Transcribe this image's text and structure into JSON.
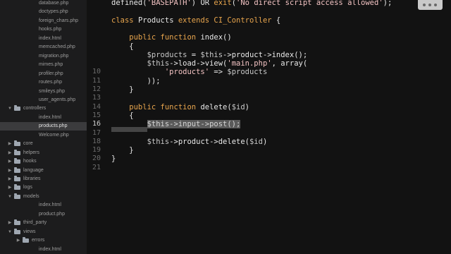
{
  "sidebar": {
    "items": [
      {
        "label": "database.php",
        "kind": "file",
        "depth": 3
      },
      {
        "label": "doctypes.php",
        "kind": "file",
        "depth": 3
      },
      {
        "label": "foreign_chars.php",
        "kind": "file",
        "depth": 3
      },
      {
        "label": "hooks.php",
        "kind": "file",
        "depth": 3
      },
      {
        "label": "index.html",
        "kind": "file",
        "depth": 3
      },
      {
        "label": "memcached.php",
        "kind": "file",
        "depth": 3
      },
      {
        "label": "migration.php",
        "kind": "file",
        "depth": 3
      },
      {
        "label": "mimes.php",
        "kind": "file",
        "depth": 3
      },
      {
        "label": "profiler.php",
        "kind": "file",
        "depth": 3
      },
      {
        "label": "routes.php",
        "kind": "file",
        "depth": 3
      },
      {
        "label": "smileys.php",
        "kind": "file",
        "depth": 3
      },
      {
        "label": "user_agents.php",
        "kind": "file",
        "depth": 3
      },
      {
        "label": "controllers",
        "kind": "folder-open",
        "depth": 2
      },
      {
        "label": "index.html",
        "kind": "file",
        "depth": 3
      },
      {
        "label": "products.php",
        "kind": "file",
        "depth": 3,
        "selected": true
      },
      {
        "label": "Welcome.php",
        "kind": "file",
        "depth": 3
      },
      {
        "label": "core",
        "kind": "folder",
        "depth": 2
      },
      {
        "label": "helpers",
        "kind": "folder",
        "depth": 2
      },
      {
        "label": "hooks",
        "kind": "folder",
        "depth": 2
      },
      {
        "label": "language",
        "kind": "folder",
        "depth": 2
      },
      {
        "label": "libraries",
        "kind": "folder",
        "depth": 2
      },
      {
        "label": "logs",
        "kind": "folder",
        "depth": 2
      },
      {
        "label": "models",
        "kind": "folder-open",
        "depth": 2
      },
      {
        "label": "index.html",
        "kind": "file",
        "depth": 3
      },
      {
        "label": "product.php",
        "kind": "file",
        "depth": 3
      },
      {
        "label": "third_party",
        "kind": "folder",
        "depth": 2
      },
      {
        "label": "views",
        "kind": "folder-open",
        "depth": 2
      },
      {
        "label": "errors",
        "kind": "folder",
        "depth": 3
      },
      {
        "label": "index.html",
        "kind": "file",
        "depth": 3
      }
    ]
  },
  "editor": {
    "active_line": "16",
    "lines": [
      {
        "num": "",
        "tokens": [
          {
            "t": "defined(",
            "c": "fn"
          },
          {
            "t": "'BASEPATH'",
            "c": "str"
          },
          {
            "t": ") OR ",
            "c": "fn"
          },
          {
            "t": "exit",
            "c": "kw"
          },
          {
            "t": "(",
            "c": "fn"
          },
          {
            "t": "'No direct script access allowed'",
            "c": "str"
          },
          {
            "t": ");",
            "c": "fn"
          }
        ]
      },
      {
        "num": "",
        "tokens": []
      },
      {
        "num": "",
        "tokens": [
          {
            "t": "class ",
            "c": "kw"
          },
          {
            "t": "Products ",
            "c": "fn"
          },
          {
            "t": "extends ",
            "c": "kw"
          },
          {
            "t": "CI_Controller",
            "c": "const"
          },
          {
            "t": " {",
            "c": "fn"
          }
        ]
      },
      {
        "num": "",
        "tokens": []
      },
      {
        "num": "",
        "tokens": [
          {
            "t": "    public function ",
            "c": "kw"
          },
          {
            "t": "index()",
            "c": "fn"
          }
        ]
      },
      {
        "num": "",
        "tokens": [
          {
            "t": "    {",
            "c": "fn"
          }
        ]
      },
      {
        "num": "",
        "tokens": [
          {
            "t": "        $products",
            "c": "var"
          },
          {
            "t": " = ",
            "c": "fn"
          },
          {
            "t": "$this",
            "c": "var"
          },
          {
            "t": "->product->index();",
            "c": "fn"
          }
        ]
      },
      {
        "num": "",
        "tokens": [
          {
            "t": "        $this",
            "c": "var"
          },
          {
            "t": "->load->view(",
            "c": "fn"
          },
          {
            "t": "'main.php'",
            "c": "str"
          },
          {
            "t": ", array(",
            "c": "fn"
          }
        ]
      },
      {
        "num": "10",
        "tokens": [
          {
            "t": "            ",
            "c": "fn"
          },
          {
            "t": "'products'",
            "c": "str"
          },
          {
            "t": " => ",
            "c": "fn"
          },
          {
            "t": "$products",
            "c": "var"
          }
        ]
      },
      {
        "num": "11",
        "tokens": [
          {
            "t": "        ));",
            "c": "fn"
          }
        ]
      },
      {
        "num": "12",
        "tokens": [
          {
            "t": "    }",
            "c": "fn"
          }
        ]
      },
      {
        "num": "13",
        "tokens": []
      },
      {
        "num": "14",
        "tokens": [
          {
            "t": "    public function ",
            "c": "kw"
          },
          {
            "t": "delete(",
            "c": "fn"
          },
          {
            "t": "$id",
            "c": "var"
          },
          {
            "t": ")",
            "c": "fn"
          }
        ]
      },
      {
        "num": "15",
        "tokens": [
          {
            "t": "    {",
            "c": "fn"
          }
        ]
      },
      {
        "num": "16",
        "tokens": [
          {
            "t": "        ",
            "c": "fn"
          },
          {
            "t": "$this->input->post();",
            "c": "sel"
          }
        ]
      },
      {
        "num": "17",
        "tokens": []
      },
      {
        "num": "18",
        "tokens": [
          {
            "t": "        $this",
            "c": "var"
          },
          {
            "t": "->product->delete(",
            "c": "fn"
          },
          {
            "t": "$id",
            "c": "var"
          },
          {
            "t": ")",
            "c": "fn"
          }
        ]
      },
      {
        "num": "19",
        "tokens": [
          {
            "t": "    }",
            "c": "fn"
          }
        ]
      },
      {
        "num": "20",
        "tokens": [
          {
            "t": "}",
            "c": "fn"
          }
        ]
      },
      {
        "num": "21",
        "tokens": []
      }
    ]
  }
}
